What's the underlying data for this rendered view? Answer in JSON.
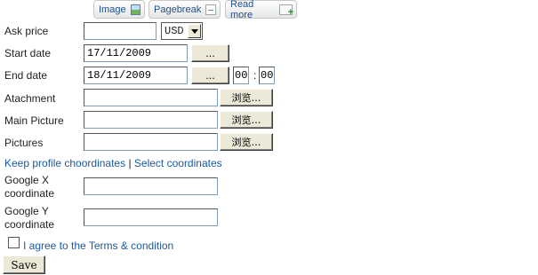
{
  "toolbar": {
    "image_label": "Image",
    "pagebreak_label": "Pagebreak",
    "readmore_label": "Read more"
  },
  "ask_price": {
    "label": "Ask price",
    "value": "",
    "currency": "USD"
  },
  "start_date": {
    "label": "Start date",
    "value": "17/11/2009",
    "picker_label": "..."
  },
  "end_date": {
    "label": "End date",
    "value": "18/11/2009",
    "picker_label": "...",
    "hour": "00",
    "time_sep": ":",
    "minute": "00"
  },
  "attachment": {
    "label": "Atachment",
    "browse_label": "浏览…"
  },
  "main_picture": {
    "label": "Main Picture",
    "browse_label": "浏览…"
  },
  "pictures": {
    "label": "Pictures",
    "browse_label": "浏览…"
  },
  "coords_links": {
    "keep_label": "Keep profile choordinates",
    "separator": "|",
    "select_label": "Select coordinates"
  },
  "google_x": {
    "label_line1": "Google X",
    "label_line2": "coordinate",
    "value": ""
  },
  "google_y": {
    "label_line1": "Google Y",
    "label_line2": "coordinate",
    "value": ""
  },
  "terms": {
    "label": "I agree to the Terms & condition",
    "checked": false
  },
  "save_label": "Save"
}
